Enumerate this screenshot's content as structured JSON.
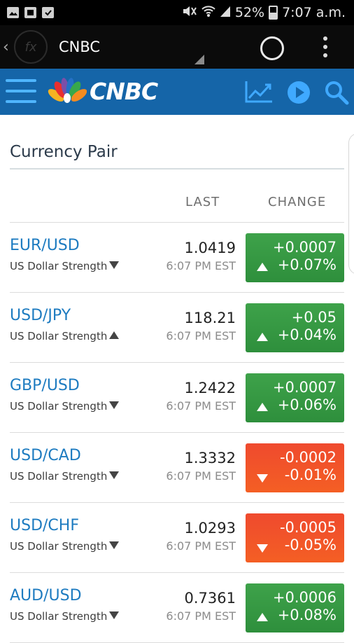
{
  "status_bar": {
    "battery": "52%",
    "time": "7:07 a.m.",
    "icons": [
      "photo-icon",
      "sim-icon",
      "briefcase-icon",
      "mute-icon",
      "wifi-icon",
      "signal-icon",
      "battery-icon"
    ]
  },
  "app_bar": {
    "title": "CNBC",
    "back_glyph": "‹",
    "logo_glyph": "fx"
  },
  "header": {
    "brand": "CNBC",
    "accent": "#1565a8",
    "icons": [
      "menu-icon",
      "chart-icon",
      "play-icon",
      "search-icon"
    ]
  },
  "page": {
    "section_title": "Currency Pair",
    "col_last": "LAST",
    "col_change": "CHANGE"
  },
  "colors": {
    "up": "#36994a",
    "down": "#f05029",
    "pair_link": "#1d7bc0"
  },
  "rows": [
    {
      "pair": "EUR/USD",
      "strength": "US Dollar Strength",
      "strength_dir": "down",
      "last": "1.0419",
      "time": "6:07 PM EST",
      "change": "+0.0007",
      "pct": "+0.07%",
      "dir": "up"
    },
    {
      "pair": "USD/JPY",
      "strength": "US Dollar Strength",
      "strength_dir": "up",
      "last": "118.21",
      "time": "6:07 PM EST",
      "change": "+0.05",
      "pct": "+0.04%",
      "dir": "up"
    },
    {
      "pair": "GBP/USD",
      "strength": "US Dollar Strength",
      "strength_dir": "down",
      "last": "1.2422",
      "time": "6:07 PM EST",
      "change": "+0.0007",
      "pct": "+0.06%",
      "dir": "up"
    },
    {
      "pair": "USD/CAD",
      "strength": "US Dollar Strength",
      "strength_dir": "down",
      "last": "1.3332",
      "time": "6:07 PM EST",
      "change": "-0.0002",
      "pct": "-0.01%",
      "dir": "down"
    },
    {
      "pair": "USD/CHF",
      "strength": "US Dollar Strength",
      "strength_dir": "down",
      "last": "1.0293",
      "time": "6:07 PM EST",
      "change": "-0.0005",
      "pct": "-0.05%",
      "dir": "down"
    },
    {
      "pair": "AUD/USD",
      "strength": "US Dollar Strength",
      "strength_dir": "down",
      "last": "0.7361",
      "time": "6:07 PM EST",
      "change": "+0.0006",
      "pct": "+0.08%",
      "dir": "up"
    }
  ]
}
